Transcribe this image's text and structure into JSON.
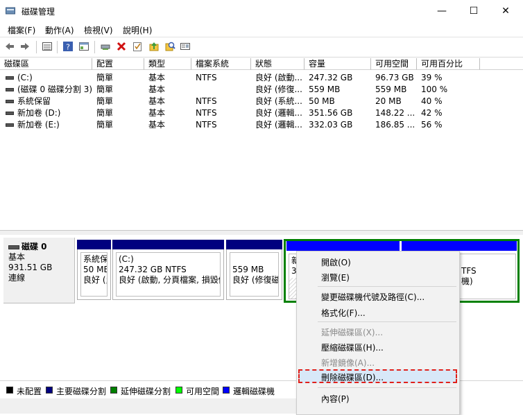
{
  "window": {
    "title": "磁碟管理",
    "minimize": "—",
    "maximize": "☐",
    "close": "✕"
  },
  "menu": [
    "檔案(F)",
    "動作(A)",
    "檢視(V)",
    "說明(H)"
  ],
  "toolbar_icons": [
    "back-icon",
    "forward-icon",
    "list-view-icon",
    "help-icon",
    "properties-icon",
    "connect-disk-icon",
    "delete-icon",
    "check-icon",
    "up-icon",
    "search-icon",
    "details-icon"
  ],
  "columns": [
    "磁碟區",
    "配置",
    "類型",
    "檔案系統",
    "狀態",
    "容量",
    "可用空間",
    "可用百分比"
  ],
  "volumes": [
    [
      "(C:)",
      "簡單",
      "基本",
      "NTFS",
      "良好 (啟動...",
      "247.32 GB",
      "96.73 GB",
      "39 %"
    ],
    [
      "(磁碟 0 磁碟分割 3)",
      "簡單",
      "基本",
      "",
      "良好 (修復...",
      "559 MB",
      "559 MB",
      "100 %"
    ],
    [
      "系統保留",
      "簡單",
      "基本",
      "NTFS",
      "良好 (系統...",
      "50 MB",
      "20 MB",
      "40 %"
    ],
    [
      "新加卷 (D:)",
      "簡單",
      "基本",
      "NTFS",
      "良好 (邏輯...",
      "351.56 GB",
      "148.22 ...",
      "42 %"
    ],
    [
      "新加卷 (E:)",
      "簡單",
      "基本",
      "NTFS",
      "良好 (邏輯...",
      "332.03 GB",
      "186.85 ...",
      "56 %"
    ]
  ],
  "disk": {
    "name": "磁碟 0",
    "type": "基本",
    "size": "931.51 GB",
    "status": "連線"
  },
  "partitions": [
    {
      "name": "系統保",
      "size": "50 MB",
      "status": "良好 (;"
    },
    {
      "name": "(C:)",
      "size": "247.32 GB NTFS",
      "status": "良好 (啟動, 分頁檔案, 損毀傾"
    },
    {
      "name": "",
      "size": "559 MB",
      "status": "良好 (修復磁"
    },
    {
      "name": "新",
      "size": "3",
      "status": ""
    },
    {
      "name": "",
      "size": "TFS",
      "status": "機)"
    }
  ],
  "legend": [
    {
      "label": "未配置",
      "color": "#000000"
    },
    {
      "label": "主要磁碟分割",
      "color": "#00007f"
    },
    {
      "label": "延伸磁碟分割",
      "color": "#008000"
    },
    {
      "label": "可用空間",
      "color": "#00ff00"
    },
    {
      "label": "邏輯磁碟機",
      "color": "#0000ff"
    }
  ],
  "context_menu": {
    "items": [
      {
        "label": "開啟(O)",
        "enabled": true
      },
      {
        "label": "瀏覽(E)",
        "enabled": true
      },
      {
        "label": "變更磁碟機代號及路徑(C)...",
        "enabled": true
      },
      {
        "label": "格式化(F)...",
        "enabled": true
      },
      {
        "label": "延伸磁碟區(X)...",
        "enabled": false
      },
      {
        "label": "壓縮磁碟區(H)...",
        "enabled": true
      },
      {
        "label": "新增鏡像(A)...",
        "enabled": false
      },
      {
        "label": "刪除磁碟區(D)...",
        "enabled": true,
        "highlighted": true
      },
      {
        "label": "內容(P)",
        "enabled": true
      }
    ],
    "highlight_color": "#e0201a"
  }
}
